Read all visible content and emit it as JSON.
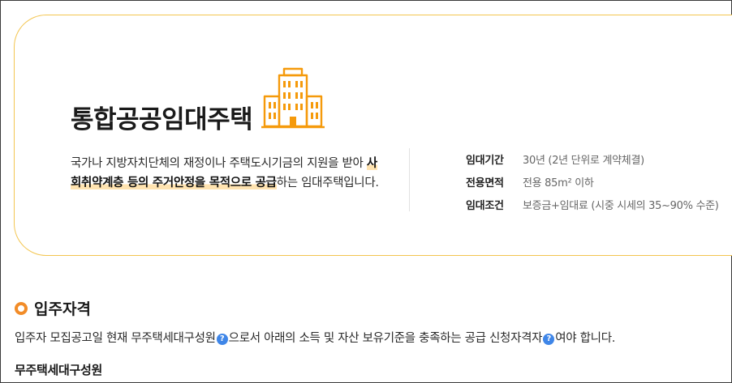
{
  "housing_card": {
    "title": "통합공공임대주택",
    "icon": "apartment-building-icon",
    "description_pre": "국가나 지방자치단체의 재정이나 주택도시기금의 지원을 받아 ",
    "description_highlight": "사회취약계층 등의 주거안정을 목적으로 공급",
    "description_post": "하는 임대주택입니다.",
    "info": [
      {
        "label": "임대기간",
        "value": "30년 (2년 단위로 계약체결)"
      },
      {
        "label": "전용면적",
        "value": "전용 85m² 이하"
      },
      {
        "label": "임대조건",
        "value": "보증금+임대료 (시중 시세의 35~90% 수준)"
      }
    ]
  },
  "qualification": {
    "title": "입주자격",
    "text_part1": "입주자 모집공고일 현재 무주택세대구성원",
    "text_part2": "으로서 아래의 소득 및 자산 보유기준을 충족하는 공급 신청자격자",
    "text_part3": "여야 합니다.",
    "help_glyph": "?",
    "subheading": "무주택세대구성원"
  },
  "colors": {
    "accent": "#f59a0b",
    "card_border": "#f3c54f",
    "bullet": "#f28c28",
    "help": "#3f86e8",
    "highlight": "#ffe3b0"
  }
}
